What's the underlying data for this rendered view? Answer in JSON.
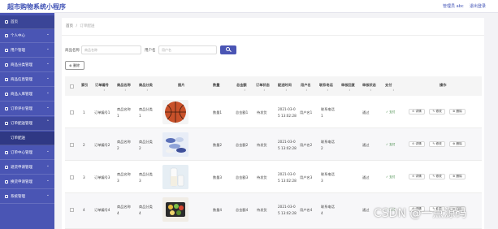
{
  "header": {
    "app_title": "超市购物系统小程序",
    "admin_label": "管理员 abc",
    "logout_label": "退出登录"
  },
  "sidebar": {
    "items": [
      {
        "label": "首页",
        "icon": "home-icon"
      },
      {
        "label": "个人中心",
        "icon": "user-icon"
      },
      {
        "label": "用户管理",
        "icon": "users-icon"
      },
      {
        "label": "商品分类管理",
        "icon": "category-icon"
      },
      {
        "label": "商品信息管理",
        "icon": "product-icon"
      },
      {
        "label": "商品入库管理",
        "icon": "inbound-icon"
      },
      {
        "label": "订单评价管理",
        "icon": "review-icon"
      },
      {
        "label": "订单配送管理",
        "icon": "delivery-icon"
      },
      {
        "label": "订单配送",
        "icon": ""
      },
      {
        "label": "订单中心管理",
        "icon": "order-icon"
      },
      {
        "label": "退货申请管理",
        "icon": "return-icon"
      },
      {
        "label": "换货申请管理",
        "icon": "exchange-icon"
      },
      {
        "label": "系统管理",
        "icon": "settings-icon"
      }
    ]
  },
  "breadcrumb": {
    "home": "首页",
    "separator": "/",
    "current": "订单配送"
  },
  "filters": {
    "product_name_label": "商品名称",
    "product_name_placeholder": "商品名称",
    "username_label": "用户名",
    "username_placeholder": "用户名"
  },
  "toolbar": {
    "delete_label": "删除"
  },
  "table": {
    "columns": [
      "索引",
      "订单编号",
      "商品名称",
      "商品分类",
      "图片",
      "数量",
      "总金额",
      "订单状态",
      "配送时间",
      "用户名",
      "联系电话",
      "审核回复",
      "审核状态",
      "支付",
      "操作"
    ],
    "rows": [
      {
        "index": "1",
        "order_no": [
          "订单编号1"
        ],
        "name": [
          "商品名称",
          "1"
        ],
        "category": [
          "商品分类",
          "1"
        ],
        "image": "basketball",
        "qty": "数量1",
        "total": "总金额1",
        "status": "待发货",
        "time": [
          "2021-03-0",
          "5 13:02:28"
        ],
        "user": "用户名1",
        "phone": [
          "联系电话",
          "1"
        ],
        "reply": "",
        "audit": "通过",
        "pay": "已支付"
      },
      {
        "index": "2",
        "order_no": [
          "订单编号2"
        ],
        "name": [
          "商品名称",
          "2"
        ],
        "category": [
          "商品分类",
          "2"
        ],
        "image": "candies",
        "qty": "数量2",
        "total": "总金额2",
        "status": "待发货",
        "time": [
          "2021-03-0",
          "5 13:02:28"
        ],
        "user": "用户名2",
        "phone": [
          "联系电话",
          "2"
        ],
        "reply": "",
        "audit": "通过",
        "pay": "已支付"
      },
      {
        "index": "3",
        "order_no": [
          "订单编号3"
        ],
        "name": [
          "商品名称",
          "3"
        ],
        "category": [
          "商品分类",
          "3"
        ],
        "image": "milk",
        "qty": "数量3",
        "total": "总金额3",
        "status": "待发货",
        "time": [
          "2021-03-0",
          "5 13:02:28"
        ],
        "user": "用户名3",
        "phone": [
          "联系电话",
          "3"
        ],
        "reply": "",
        "audit": "通过",
        "pay": "已支付"
      },
      {
        "index": "4",
        "order_no": [
          "订单编号4"
        ],
        "name": [
          "商品名称",
          "4"
        ],
        "category": [
          "商品分类",
          "4"
        ],
        "image": "fruit-box",
        "qty": "数量4",
        "total": "总金额4",
        "status": "待发货",
        "time": [
          "2021-03-0",
          "5 13:02:28"
        ],
        "user": "用户名4",
        "phone": [
          "联系电话",
          "4"
        ],
        "reply": "",
        "audit": "通过",
        "pay": "已支付"
      }
    ],
    "actions": [
      "详情",
      "修改",
      "删除"
    ],
    "pay_button_label": "支付"
  },
  "watermark": "CSDN @一点源码",
  "colors": {
    "primary": "#4a55b4",
    "sidebar": "#4a55b4",
    "pay_green": "#2e7d32"
  }
}
